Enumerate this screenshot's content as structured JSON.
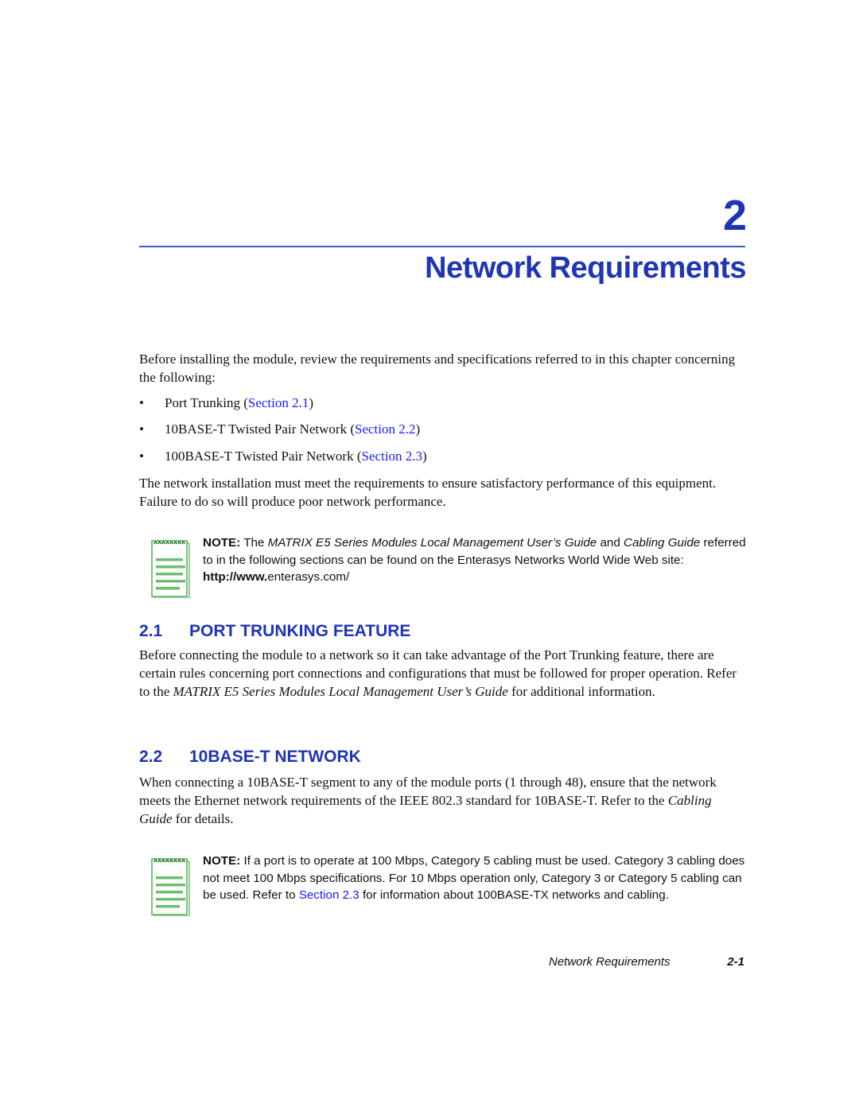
{
  "chapter": {
    "number": "2",
    "title": "Network Requirements"
  },
  "intro": {
    "text": "Before installing the module, review the requirements and specifications referred to in this chapter concerning the following:"
  },
  "bullets": [
    {
      "symbol": "•",
      "text": "Port Trunking (",
      "link": "Section 2.1",
      "after": ")"
    },
    {
      "symbol": "•",
      "text": "10BASE-T Twisted Pair Network (",
      "link": "Section 2.2",
      "after": ")"
    },
    {
      "symbol": "•",
      "text": "100BASE-T Twisted Pair Network (",
      "link": "Section 2.3",
      "after": ")"
    }
  ],
  "requirement_para": "The network installation must meet the requirements to ensure satisfactory performance of this equipment. Failure to do so will produce poor network performance.",
  "note1": {
    "icon": "notepad-icon",
    "label": "NOTE:",
    "pre": " The ",
    "italic1": "MATRIX E5 Series Modules Local Management User’s Guide",
    "mid": " and ",
    "italic2": "Cabling Guide",
    "post": " referred to in the following sections can be found on the Enterasys Networks World Wide Web site: ",
    "url_bold": "http://www.",
    "url_rest": "enterasys.com/"
  },
  "section21": {
    "number": "2.1",
    "title": "PORT TRUNKING FEATURE",
    "pre": "Before connecting the module to a network so it can take advantage of the Port Trunking feature, there are certain rules concerning port connections and configurations that must be followed for proper operation. Refer to the ",
    "italic": "MATRIX E5 Series Modules Local Management User’s Guide",
    "post": " for additional information."
  },
  "section22": {
    "number": "2.2",
    "title": "10BASE-T NETWORK",
    "pre": "When connecting a 10BASE-T segment to any of the module ports (1 through 48), ensure that the network meets the Ethernet network requirements of the IEEE 802.3 standard for 10BASE-T. Refer to the ",
    "italic": "Cabling Guide",
    "post": " for details."
  },
  "note2": {
    "icon": "notepad-icon",
    "label": "NOTE:",
    "pre": " If a port is to operate at 100 Mbps, Category 5 cabling must be used. Category 3 cabling does not meet 100 Mbps specifications. For 10 Mbps operation only, Category 3 or Category 5 cabling can be used. Refer to ",
    "link": "Section 2.3",
    "post": " for information about 100BASE-TX networks and cabling."
  },
  "footer": {
    "title": "Network Requirements",
    "page": "2-1"
  },
  "colors": {
    "heading_blue": "#1f35b5",
    "link_blue": "#1a1aff",
    "note_icon_green": "#4caf50"
  }
}
